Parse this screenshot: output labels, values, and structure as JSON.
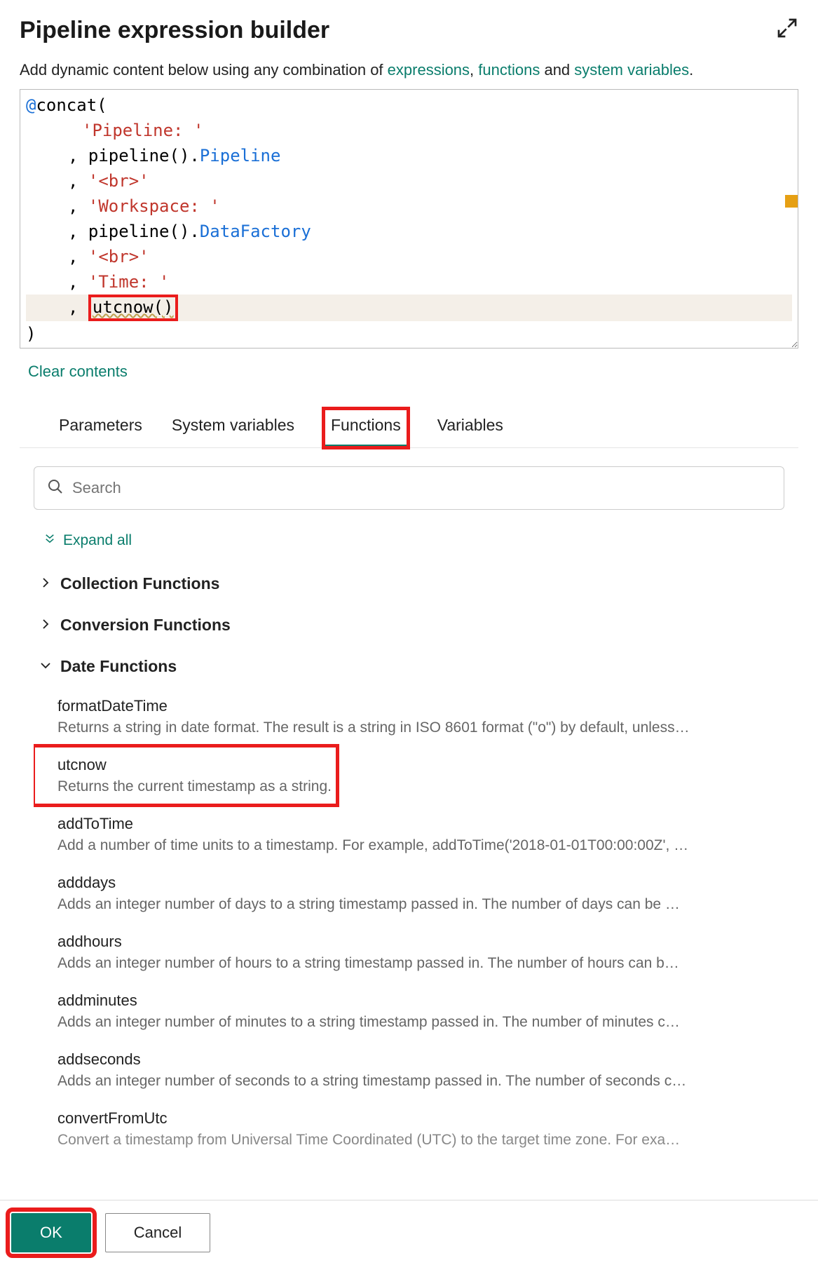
{
  "title": "Pipeline expression builder",
  "hint": {
    "prefix": "Add dynamic content below using any combination of ",
    "link1": "expressions",
    "sep1": ", ",
    "link2": "functions",
    "mid": " and ",
    "link3": "system variables",
    "suffix": "."
  },
  "code": {
    "l1_at": "@",
    "l1_fn": "concat",
    "l1_paren": "(",
    "l2": "'Pipeline: '",
    "l3_comma": ", ",
    "l3_a": "pipeline().",
    "l3_b": "Pipeline",
    "l4_comma": ", ",
    "l4": "'<br>'",
    "l5_comma": ", ",
    "l5": "'Workspace: '",
    "l6_comma": ", ",
    "l6_a": "pipeline().",
    "l6_b": "DataFactory",
    "l7_comma": ", ",
    "l7": "'<br>'",
    "l8_comma": ", ",
    "l8": "'Time: '",
    "l9_comma": ", ",
    "l9_box": "utcnow()",
    "l10": ")"
  },
  "clear_contents": "Clear contents",
  "tabs": {
    "parameters": "Parameters",
    "system_variables": "System variables",
    "functions": "Functions",
    "variables": "Variables"
  },
  "search_placeholder": "Search",
  "expand_all": "Expand all",
  "groups": {
    "collection": "Collection Functions",
    "conversion": "Conversion Functions",
    "date": "Date Functions"
  },
  "functions": [
    {
      "name": "formatDateTime",
      "desc": "Returns a string in date format. The result is a string in ISO 8601 format (\"o\") by default, unless…"
    },
    {
      "name": "utcnow",
      "desc": "Returns the current timestamp as a string."
    },
    {
      "name": "addToTime",
      "desc": "Add a number of time units to a timestamp. For example, addToTime('2018-01-01T00:00:00Z', …"
    },
    {
      "name": "adddays",
      "desc": "Adds an integer number of days to a string timestamp passed in. The number of days can be …"
    },
    {
      "name": "addhours",
      "desc": "Adds an integer number of hours to a string timestamp passed in. The number of hours can b…"
    },
    {
      "name": "addminutes",
      "desc": "Adds an integer number of minutes to a string timestamp passed in. The number of minutes c…"
    },
    {
      "name": "addseconds",
      "desc": "Adds an integer number of seconds to a string timestamp passed in. The number of seconds c…"
    },
    {
      "name": "convertFromUtc",
      "desc": "Convert a timestamp from Universal Time Coordinated (UTC) to the target time zone. For exa…"
    }
  ],
  "buttons": {
    "ok": "OK",
    "cancel": "Cancel"
  }
}
